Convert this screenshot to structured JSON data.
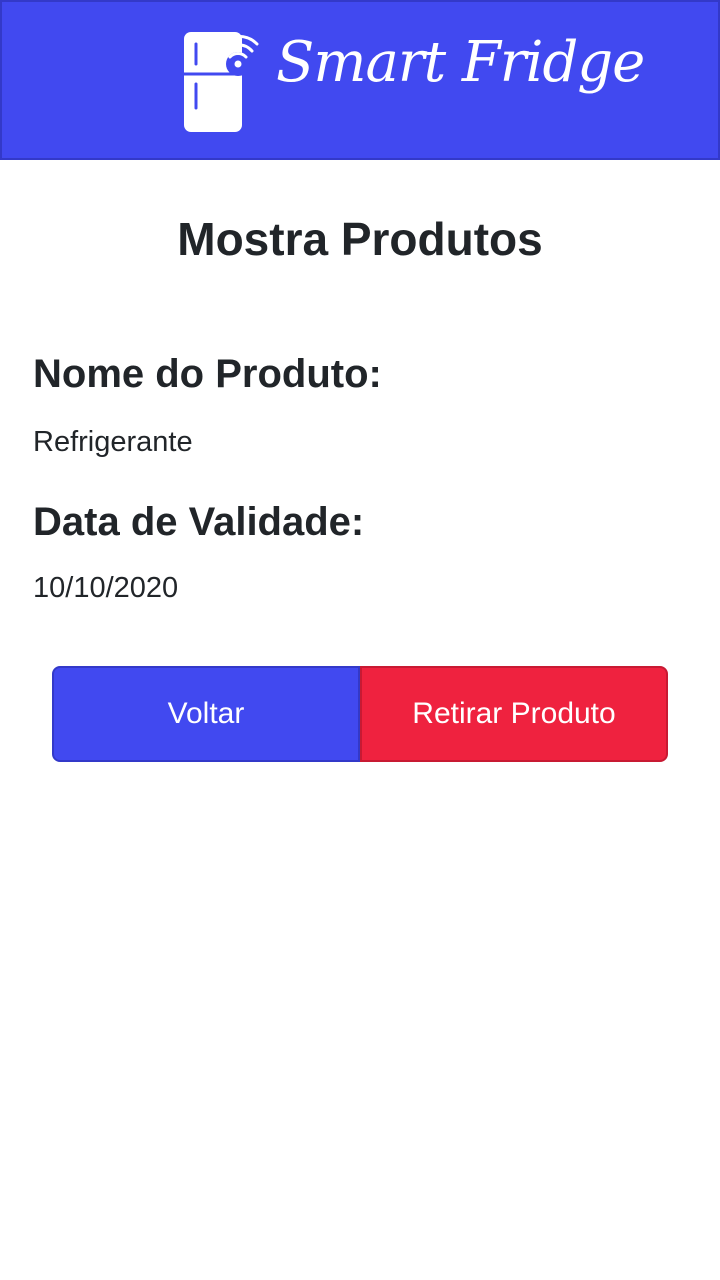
{
  "header": {
    "app_name": "Smart Fridge",
    "logo_icon": "smart-fridge-wifi-icon",
    "background_color": "#4149f0"
  },
  "page": {
    "title": "Mostra Produtos"
  },
  "product": {
    "name_label": "Nome do Produto:",
    "name_value": "Refrigerante",
    "expiry_label": "Data de Validade:",
    "expiry_value": "10/10/2020"
  },
  "actions": {
    "back_label": "Voltar",
    "back_color": "#4149f0",
    "remove_label": "Retirar Produto",
    "remove_color": "#ef223f"
  }
}
